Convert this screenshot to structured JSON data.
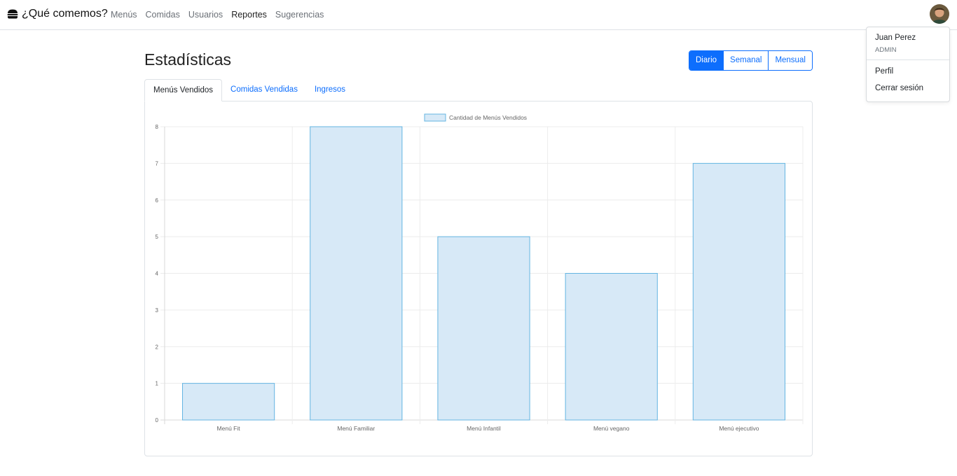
{
  "navbar": {
    "brand": "¿Qué comemos?",
    "links": [
      {
        "label": "Menús",
        "active": false
      },
      {
        "label": "Comidas",
        "active": false
      },
      {
        "label": "Usuarios",
        "active": false
      },
      {
        "label": "Reportes",
        "active": true
      },
      {
        "label": "Sugerencias",
        "active": false
      }
    ]
  },
  "user_menu": {
    "name": "Juan Perez",
    "role": "ADMIN",
    "items": [
      "Perfil",
      "Cerrar sesión"
    ]
  },
  "page": {
    "title": "Estadísticas",
    "periods": [
      {
        "label": "Diario",
        "active": true
      },
      {
        "label": "Semanal",
        "active": false
      },
      {
        "label": "Mensual",
        "active": false
      }
    ],
    "tabs": [
      {
        "label": "Menús Vendidos",
        "active": true
      },
      {
        "label": "Comidas Vendidas",
        "active": false
      },
      {
        "label": "Ingresos",
        "active": false
      }
    ]
  },
  "colors": {
    "accent": "#0d6efd",
    "bar_fill": "#d7e9f7",
    "bar_border": "#64b5e2"
  },
  "chart_data": {
    "type": "bar",
    "categories": [
      "Menú Fit",
      "Menú Familiar",
      "Menú Infantil",
      "Menú vegano",
      "Menú ejecutivo"
    ],
    "series": [
      {
        "name": "Cantidad de Menús Vendidos",
        "values": [
          1,
          8,
          5,
          4,
          7
        ]
      }
    ],
    "ylim": [
      0,
      8
    ],
    "yticks": [
      0,
      1,
      2,
      3,
      4,
      5,
      6,
      7,
      8
    ],
    "grid": true,
    "legend": "top-center"
  }
}
